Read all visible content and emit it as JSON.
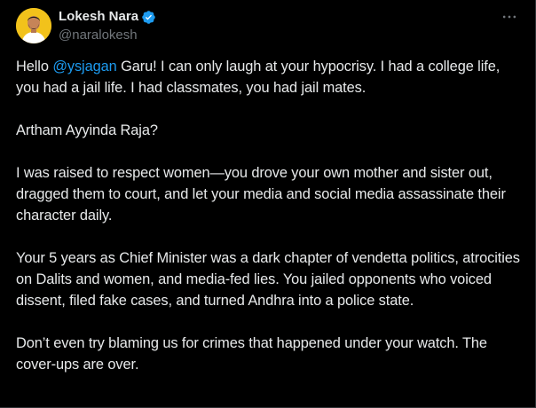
{
  "author": {
    "display_name": "Lokesh Nara",
    "handle": "@naralokesh",
    "verified": true,
    "avatar_bg": "#f2c21b"
  },
  "actions": {
    "more_icon": "more-horizontal-icon"
  },
  "tweet": {
    "p1_before": "Hello ",
    "mention": "@ysjagan",
    "p1_after": " Garu! I can only laugh at your hypocrisy. I had a college life, you had a jail life. I had classmates, you had jail mates.",
    "p2": "Artham Ayyinda Raja?",
    "p3": "I was raised to respect women—you drove your own mother and sister out, dragged them to court, and let your media and social media assassinate their character daily.",
    "p4": "Your 5 years as Chief Minister was a dark chapter of vendetta politics, atrocities on Dalits and women, and media-fed lies. You jailed opponents who voiced dissent, filed fake cases, and turned Andhra into a police state.",
    "p5": "Don’t even try blaming us for crimes that happened under your watch. The cover-ups are over."
  },
  "colors": {
    "background": "#000000",
    "text": "#e7e9ea",
    "secondary_text": "#71767b",
    "link": "#1d9bf0",
    "verified": "#1d9bf0"
  }
}
